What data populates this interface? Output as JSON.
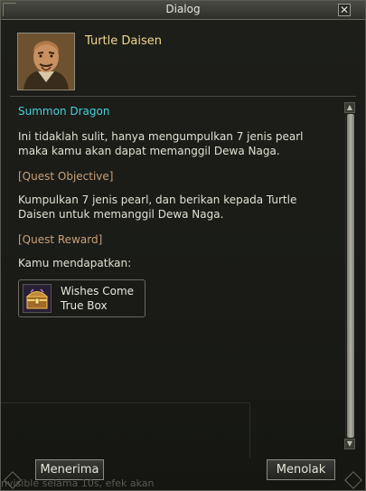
{
  "window": {
    "title": "Dialog"
  },
  "npc": {
    "name": "Turtle Daisen"
  },
  "quest": {
    "title": "Summon Dragon",
    "description": "Ini tidaklah sulit, hanya mengumpulkan 7 jenis pearl maka kamu akan dapat memanggil Dewa Naga.",
    "objective_label": "[Quest Objective]",
    "objective_text": "Kumpulkan 7 jenis pearl,  dan  berikan kepada Turtle Daisen untuk memanggil Dewa Naga.",
    "reward_label": "[Quest Reward]",
    "reward_intro": "Kamu mendapatkan:",
    "reward_item": {
      "name": "Wishes Come True Box",
      "icon": "treasure-chest-icon"
    }
  },
  "buttons": {
    "accept": "Menerima",
    "decline": "Menolak"
  },
  "background_text": "nvisible selama 10s, efek akan",
  "colors": {
    "quest_title": "#48d0d8",
    "npc_name": "#f0d88a",
    "section_label": "#c8a078"
  }
}
